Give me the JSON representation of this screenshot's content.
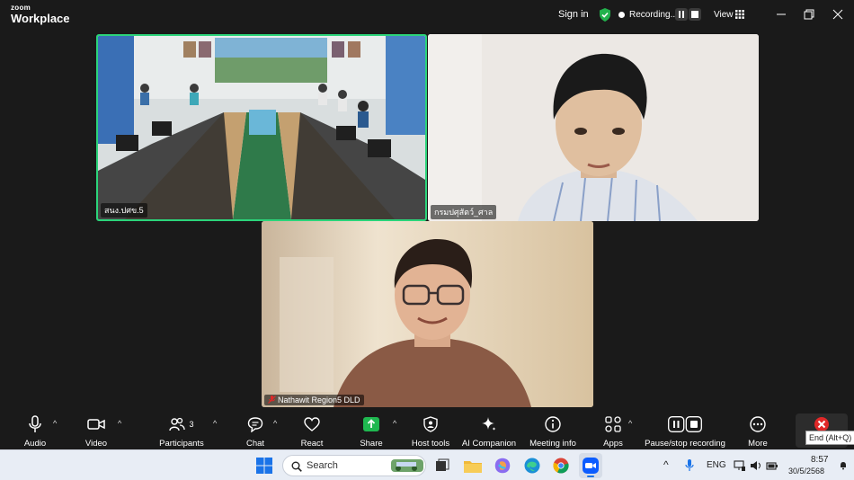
{
  "app": {
    "brand_line1": "zoom",
    "brand_line2": "Workplace"
  },
  "titlebar": {
    "signin_label": "Sign in",
    "recording_label": "Recording...",
    "view_label": "View"
  },
  "tiles": [
    {
      "name": "สนง.ปศข.5",
      "active_speaker": true
    },
    {
      "name": "กรมปศุสัตว์_ศาล"
    },
    {
      "name": "Nathawit Region5 DLD",
      "muted": true
    }
  ],
  "toolbar": {
    "audio_label": "Audio",
    "video_label": "Video",
    "participants_label": "Participants",
    "participants_count": "3",
    "chat_label": "Chat",
    "react_label": "React",
    "share_label": "Share",
    "host_tools_label": "Host tools",
    "ai_companion_label": "AI Companion",
    "meeting_info_label": "Meeting info",
    "apps_label": "Apps",
    "pause_stop_label": "Pause/stop recording",
    "more_label": "More",
    "end_tooltip": "End (Alt+Q)"
  },
  "taskbar": {
    "search_placeholder": "Search",
    "language": "ENG",
    "time": "8:57",
    "date": "30/5/2568"
  },
  "colors": {
    "active_speaker_border": "#2bd47a",
    "share_green": "#1fb850",
    "end_red": "#e02828",
    "shield_green": "#22b14c"
  }
}
